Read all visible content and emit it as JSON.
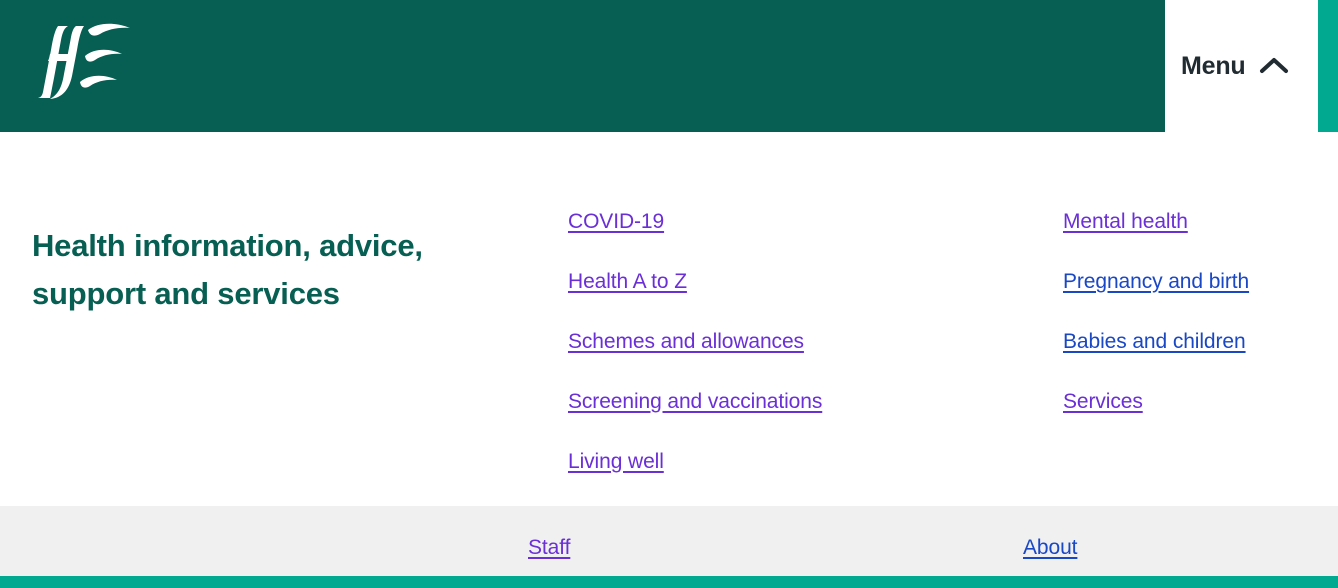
{
  "colors": {
    "header_green": "#065f52",
    "teal_accent": "#00a98f",
    "heading_green": "#065f52",
    "visited_link": "#6b2fd6",
    "unvisited_link": "#1a47c4",
    "menu_text": "#212b32",
    "secondary_band": "#f0f0f0"
  },
  "header": {
    "logo_alt": "HSE",
    "menu": {
      "label": "Menu",
      "chevron_icon": "chevron-up-icon",
      "expanded": true
    }
  },
  "menu_panel": {
    "section_title": "Health information, advice, support and services",
    "columns": [
      {
        "links": [
          {
            "label": "COVID-19",
            "state": "visited"
          },
          {
            "label": "Health A to Z",
            "state": "visited"
          },
          {
            "label": "Schemes and allowances",
            "state": "visited"
          },
          {
            "label": "Screening and vaccinations",
            "state": "visited"
          },
          {
            "label": "Living well",
            "state": "visited"
          }
        ]
      },
      {
        "links": [
          {
            "label": "Mental health",
            "state": "visited"
          },
          {
            "label": "Pregnancy and birth",
            "state": "unvisited"
          },
          {
            "label": "Babies and children",
            "state": "unvisited"
          },
          {
            "label": "Services",
            "state": "visited"
          }
        ]
      }
    ]
  },
  "secondary": {
    "links": [
      {
        "label": "Staff",
        "state": "visited"
      },
      {
        "label": "About",
        "state": "unvisited"
      }
    ]
  }
}
